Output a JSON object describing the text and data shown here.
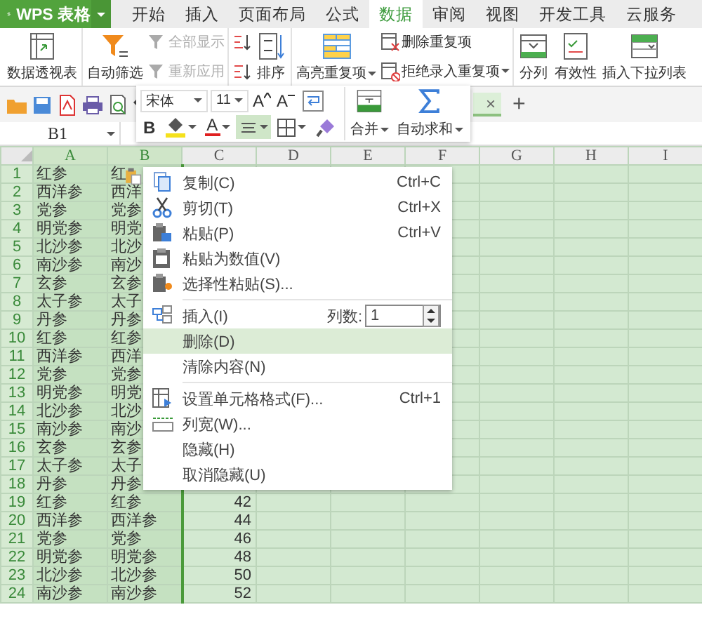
{
  "app_menu": {
    "label": "WPS 表格"
  },
  "tabs": [
    {
      "label": "开始",
      "selected": false
    },
    {
      "label": "插入",
      "selected": false
    },
    {
      "label": "页面布局",
      "selected": false
    },
    {
      "label": "公式",
      "selected": false
    },
    {
      "label": "数据",
      "selected": true
    },
    {
      "label": "审阅",
      "selected": false
    },
    {
      "label": "视图",
      "selected": false
    },
    {
      "label": "开发工具",
      "selected": false
    },
    {
      "label": "云服务",
      "selected": false
    }
  ],
  "ribbon_groups": [
    {
      "items": [
        {
          "kind": "big",
          "label": "数据透视表",
          "dropdown": false
        }
      ]
    },
    {
      "items": [
        {
          "kind": "big",
          "label": "自动筛选",
          "dropdown": false
        },
        {
          "kind": "stack",
          "buttons": [
            {
              "label": "全部显示",
              "disabled": true,
              "dropdown": false
            },
            {
              "label": "重新应用",
              "disabled": true,
              "dropdown": false
            }
          ]
        }
      ]
    },
    {
      "items": [
        {
          "kind": "sort_icons"
        },
        {
          "kind": "big",
          "label": "排序",
          "dropdown": false
        }
      ]
    },
    {
      "items": [
        {
          "kind": "big",
          "label": "高亮重复项",
          "dropdown": true
        },
        {
          "kind": "stack",
          "buttons": [
            {
              "label": "删除重复项",
              "disabled": false,
              "dropdown": false
            },
            {
              "label": "拒绝录入重复项",
              "disabled": false,
              "dropdown": true
            }
          ]
        }
      ]
    },
    {
      "items": [
        {
          "kind": "big",
          "label": "分列",
          "dropdown": false
        },
        {
          "kind": "big",
          "label": "有效性",
          "dropdown": false
        },
        {
          "kind": "big",
          "label": "插入下拉列表",
          "dropdown": false
        }
      ]
    }
  ],
  "document_tab": {
    "close": "×"
  },
  "new_tab": "+",
  "name_box": "B1",
  "mini_toolbar": {
    "font": "宋体",
    "size": "11",
    "size_buttons": [
      {
        "label": "A"
      },
      {
        "label": "A"
      }
    ],
    "format_buttons": [
      {
        "kind": "bold",
        "label": "B",
        "pressed": false
      },
      {
        "kind": "fill",
        "pressed": false
      },
      {
        "kind": "font_color",
        "label": "A",
        "pressed": false
      },
      {
        "kind": "align",
        "pressed": true
      },
      {
        "kind": "border",
        "pressed": false
      },
      {
        "kind": "painter",
        "pressed": false
      }
    ],
    "merge_label": "合并",
    "sum_label": "自动求和"
  },
  "sheet": {
    "columns": [
      {
        "label": "A",
        "selected": true,
        "copied": true
      },
      {
        "label": "B",
        "selected": true,
        "copied": false
      },
      {
        "label": "C",
        "selected": false,
        "copied": false
      },
      {
        "label": "D",
        "selected": false,
        "copied": false
      },
      {
        "label": "E",
        "selected": false,
        "copied": false
      },
      {
        "label": "F",
        "selected": false,
        "copied": false
      },
      {
        "label": "G",
        "selected": false,
        "copied": false
      },
      {
        "label": "H",
        "selected": false,
        "copied": false
      },
      {
        "label": "I",
        "selected": false,
        "copied": false
      }
    ],
    "rows": [
      {
        "number": "1",
        "a": "红参",
        "b": "红"
      },
      {
        "number": "2",
        "a": "西洋参",
        "b": "西洋"
      },
      {
        "number": "3",
        "a": "党参",
        "b": "党参"
      },
      {
        "number": "4",
        "a": "明党参",
        "b": "明党"
      },
      {
        "number": "5",
        "a": "北沙参",
        "b": "北沙"
      },
      {
        "number": "6",
        "a": "南沙参",
        "b": "南沙"
      },
      {
        "number": "7",
        "a": "玄参",
        "b": "玄参"
      },
      {
        "number": "8",
        "a": "太子参",
        "b": "太子"
      },
      {
        "number": "9",
        "a": "丹参",
        "b": "丹参"
      },
      {
        "number": "10",
        "a": "红参",
        "b": "红参"
      },
      {
        "number": "11",
        "a": "西洋参",
        "b": "西洋"
      },
      {
        "number": "12",
        "a": "党参",
        "b": "党参"
      },
      {
        "number": "13",
        "a": "明党参",
        "b": "明党"
      },
      {
        "number": "14",
        "a": "北沙参",
        "b": "北沙"
      },
      {
        "number": "15",
        "a": "南沙参",
        "b": "南沙"
      },
      {
        "number": "16",
        "a": "玄参",
        "b": "玄参"
      },
      {
        "number": "17",
        "a": "太子参",
        "b": "太子"
      },
      {
        "number": "18",
        "a": "丹参",
        "b": "丹参"
      },
      {
        "number": "19",
        "a": "红参",
        "b": "红参",
        "c": "42"
      },
      {
        "number": "20",
        "a": "西洋参",
        "b": "西洋参",
        "c": "44"
      },
      {
        "number": "21",
        "a": "党参",
        "b": "党参",
        "c": "46"
      },
      {
        "number": "22",
        "a": "明党参",
        "b": "明党参",
        "c": "48"
      },
      {
        "number": "23",
        "a": "北沙参",
        "b": "北沙参",
        "c": "50"
      },
      {
        "number": "24",
        "a": "南沙参",
        "b": "南沙参",
        "c": "52"
      }
    ]
  },
  "context_menu": [
    {
      "kind": "item",
      "label": "复制(C)",
      "shortcut": "Ctrl+C",
      "selected": false
    },
    {
      "kind": "item",
      "label": "剪切(T)",
      "shortcut": "Ctrl+X",
      "selected": false
    },
    {
      "kind": "item",
      "label": "粘贴(P)",
      "shortcut": "Ctrl+V",
      "selected": false
    },
    {
      "kind": "item",
      "label": "粘贴为数值(V)",
      "selected": false
    },
    {
      "kind": "item",
      "label": "选择性粘贴(S)...",
      "selected": false
    },
    {
      "kind": "separator"
    },
    {
      "kind": "insert",
      "label": "插入(I)",
      "count_label": "列数:",
      "count_value": "1",
      "selected": false
    },
    {
      "kind": "item",
      "label": "删除(D)",
      "selected": true
    },
    {
      "kind": "item",
      "label": "清除内容(N)",
      "selected": false
    },
    {
      "kind": "separator"
    },
    {
      "kind": "item",
      "label": "设置单元格格式(F)...",
      "shortcut": "Ctrl+1",
      "selected": false
    },
    {
      "kind": "item",
      "label": "列宽(W)...",
      "selected": false
    },
    {
      "kind": "item",
      "label": "隐藏(H)",
      "selected": false
    },
    {
      "kind": "item",
      "label": "取消隐藏(U)",
      "selected": false
    }
  ]
}
